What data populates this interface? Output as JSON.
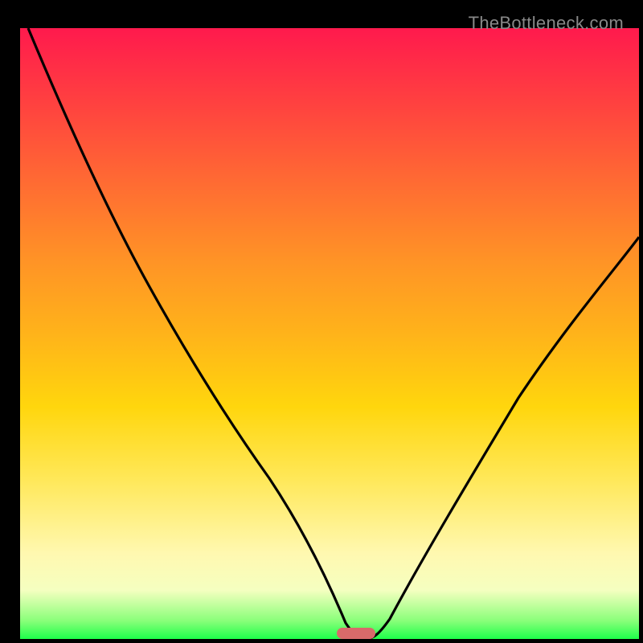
{
  "watermark": "TheBottleneck.com",
  "chart_data": {
    "type": "line",
    "title": "",
    "xlabel": "",
    "ylabel": "",
    "xlim": [
      0,
      100
    ],
    "ylim": [
      0,
      100
    ],
    "series": [
      {
        "name": "bottleneck-curve",
        "x": [
          0,
          5,
          10,
          15,
          20,
          25,
          30,
          35,
          40,
          45,
          50,
          53,
          55,
          58,
          60,
          65,
          70,
          75,
          80,
          85,
          90,
          95,
          100
        ],
        "values": [
          100,
          93,
          86,
          79,
          71,
          63,
          55,
          46,
          36,
          24,
          11,
          3,
          0,
          0,
          3,
          12,
          22,
          30,
          37,
          43,
          48,
          53,
          57
        ]
      }
    ],
    "marker": {
      "x": 56,
      "y": 0
    },
    "gradient_stops": [
      {
        "pos": 0,
        "color": "#ff1a4d"
      },
      {
        "pos": 50,
        "color": "#ffd60d"
      },
      {
        "pos": 92,
        "color": "#f5ffc0"
      },
      {
        "pos": 100,
        "color": "#1eff4a"
      }
    ]
  }
}
